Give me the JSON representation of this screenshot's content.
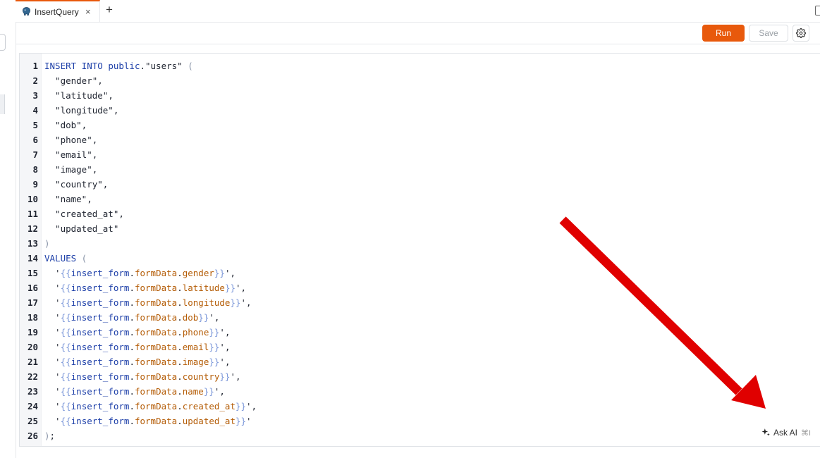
{
  "tab": {
    "title": "InsertQuery",
    "close_glyph": "×",
    "add_glyph": "+",
    "icon": "postgres-elephant-icon"
  },
  "toolbar": {
    "run_label": "Run",
    "save_label": "Save",
    "settings_icon": "gear-icon",
    "run_color": "#e8590c"
  },
  "editor": {
    "lines": [
      {
        "n": "1",
        "parts": [
          [
            "kw",
            "INSERT INTO "
          ],
          [
            "kw",
            "public"
          ],
          [
            "txt",
            "."
          ],
          [
            "str",
            "\"users\""
          ],
          [
            "paren",
            " ("
          ]
        ]
      },
      {
        "n": "2",
        "parts": [
          [
            "str",
            "  \"gender\""
          ],
          [
            "txt",
            ","
          ]
        ]
      },
      {
        "n": "3",
        "parts": [
          [
            "str",
            "  \"latitude\""
          ],
          [
            "txt",
            ","
          ]
        ]
      },
      {
        "n": "4",
        "parts": [
          [
            "str",
            "  \"longitude\""
          ],
          [
            "txt",
            ","
          ]
        ]
      },
      {
        "n": "5",
        "parts": [
          [
            "str",
            "  \"dob\""
          ],
          [
            "txt",
            ","
          ]
        ]
      },
      {
        "n": "6",
        "parts": [
          [
            "str",
            "  \"phone\""
          ],
          [
            "txt",
            ","
          ]
        ]
      },
      {
        "n": "7",
        "parts": [
          [
            "str",
            "  \"email\""
          ],
          [
            "txt",
            ","
          ]
        ]
      },
      {
        "n": "8",
        "parts": [
          [
            "str",
            "  \"image\""
          ],
          [
            "txt",
            ","
          ]
        ]
      },
      {
        "n": "9",
        "parts": [
          [
            "str",
            "  \"country\""
          ],
          [
            "txt",
            ","
          ]
        ]
      },
      {
        "n": "10",
        "parts": [
          [
            "str",
            "  \"name\""
          ],
          [
            "txt",
            ","
          ]
        ]
      },
      {
        "n": "11",
        "parts": [
          [
            "str",
            "  \"created_at\""
          ],
          [
            "txt",
            ","
          ]
        ]
      },
      {
        "n": "12",
        "parts": [
          [
            "str",
            "  \"updated_at\""
          ]
        ]
      },
      {
        "n": "13",
        "parts": [
          [
            "paren",
            ")"
          ]
        ]
      },
      {
        "n": "14",
        "parts": [
          [
            "kw",
            "VALUES"
          ],
          [
            "paren",
            " ("
          ]
        ]
      },
      {
        "n": "15",
        "parts": [
          [
            "txt",
            "  '"
          ],
          [
            "brace",
            "{{"
          ],
          [
            "ident",
            "insert_form"
          ],
          [
            "dot",
            "."
          ],
          [
            "fld",
            "formData"
          ],
          [
            "dot",
            "."
          ],
          [
            "fld",
            "gender"
          ],
          [
            "brace",
            "}}"
          ],
          [
            "txt",
            "',"
          ]
        ]
      },
      {
        "n": "16",
        "parts": [
          [
            "txt",
            "  '"
          ],
          [
            "brace",
            "{{"
          ],
          [
            "ident",
            "insert_form"
          ],
          [
            "dot",
            "."
          ],
          [
            "fld",
            "formData"
          ],
          [
            "dot",
            "."
          ],
          [
            "fld",
            "latitude"
          ],
          [
            "brace",
            "}}"
          ],
          [
            "txt",
            "',"
          ]
        ]
      },
      {
        "n": "17",
        "parts": [
          [
            "txt",
            "  '"
          ],
          [
            "brace",
            "{{"
          ],
          [
            "ident",
            "insert_form"
          ],
          [
            "dot",
            "."
          ],
          [
            "fld",
            "formData"
          ],
          [
            "dot",
            "."
          ],
          [
            "fld",
            "longitude"
          ],
          [
            "brace",
            "}}"
          ],
          [
            "txt",
            "',"
          ]
        ]
      },
      {
        "n": "18",
        "parts": [
          [
            "txt",
            "  '"
          ],
          [
            "brace",
            "{{"
          ],
          [
            "ident",
            "insert_form"
          ],
          [
            "dot",
            "."
          ],
          [
            "fld",
            "formData"
          ],
          [
            "dot",
            "."
          ],
          [
            "fld",
            "dob"
          ],
          [
            "brace",
            "}}"
          ],
          [
            "txt",
            "',"
          ]
        ]
      },
      {
        "n": "19",
        "parts": [
          [
            "txt",
            "  '"
          ],
          [
            "brace",
            "{{"
          ],
          [
            "ident",
            "insert_form"
          ],
          [
            "dot",
            "."
          ],
          [
            "fld",
            "formData"
          ],
          [
            "dot",
            "."
          ],
          [
            "fld",
            "phone"
          ],
          [
            "brace",
            "}}"
          ],
          [
            "txt",
            "',"
          ]
        ]
      },
      {
        "n": "20",
        "parts": [
          [
            "txt",
            "  '"
          ],
          [
            "brace",
            "{{"
          ],
          [
            "ident",
            "insert_form"
          ],
          [
            "dot",
            "."
          ],
          [
            "fld",
            "formData"
          ],
          [
            "dot",
            "."
          ],
          [
            "fld",
            "email"
          ],
          [
            "brace",
            "}}"
          ],
          [
            "txt",
            "',"
          ]
        ]
      },
      {
        "n": "21",
        "parts": [
          [
            "txt",
            "  '"
          ],
          [
            "brace",
            "{{"
          ],
          [
            "ident",
            "insert_form"
          ],
          [
            "dot",
            "."
          ],
          [
            "fld",
            "formData"
          ],
          [
            "dot",
            "."
          ],
          [
            "fld",
            "image"
          ],
          [
            "brace",
            "}}"
          ],
          [
            "txt",
            "',"
          ]
        ]
      },
      {
        "n": "22",
        "parts": [
          [
            "txt",
            "  '"
          ],
          [
            "brace",
            "{{"
          ],
          [
            "ident",
            "insert_form"
          ],
          [
            "dot",
            "."
          ],
          [
            "fld",
            "formData"
          ],
          [
            "dot",
            "."
          ],
          [
            "fld",
            "country"
          ],
          [
            "brace",
            "}}"
          ],
          [
            "txt",
            "',"
          ]
        ]
      },
      {
        "n": "23",
        "parts": [
          [
            "txt",
            "  '"
          ],
          [
            "brace",
            "{{"
          ],
          [
            "ident",
            "insert_form"
          ],
          [
            "dot",
            "."
          ],
          [
            "fld",
            "formData"
          ],
          [
            "dot",
            "."
          ],
          [
            "fld",
            "name"
          ],
          [
            "brace",
            "}}"
          ],
          [
            "txt",
            "',"
          ]
        ]
      },
      {
        "n": "24",
        "parts": [
          [
            "txt",
            "  '"
          ],
          [
            "brace",
            "{{"
          ],
          [
            "ident",
            "insert_form"
          ],
          [
            "dot",
            "."
          ],
          [
            "fld",
            "formData"
          ],
          [
            "dot",
            "."
          ],
          [
            "fld",
            "created_at"
          ],
          [
            "brace",
            "}}"
          ],
          [
            "txt",
            "',"
          ]
        ]
      },
      {
        "n": "25",
        "parts": [
          [
            "txt",
            "  '"
          ],
          [
            "brace",
            "{{"
          ],
          [
            "ident",
            "insert_form"
          ],
          [
            "dot",
            "."
          ],
          [
            "fld",
            "formData"
          ],
          [
            "dot",
            "."
          ],
          [
            "fld",
            "updated_at"
          ],
          [
            "brace",
            "}}"
          ],
          [
            "txt",
            "'"
          ]
        ]
      },
      {
        "n": "26",
        "parts": [
          [
            "paren",
            ")"
          ],
          [
            "txt",
            ";"
          ]
        ]
      }
    ]
  },
  "ask_ai": {
    "label": "Ask AI",
    "shortcut": "⌘I",
    "icon": "sparkle-icon"
  },
  "annotation": {
    "arrow_color": "#e00000"
  }
}
